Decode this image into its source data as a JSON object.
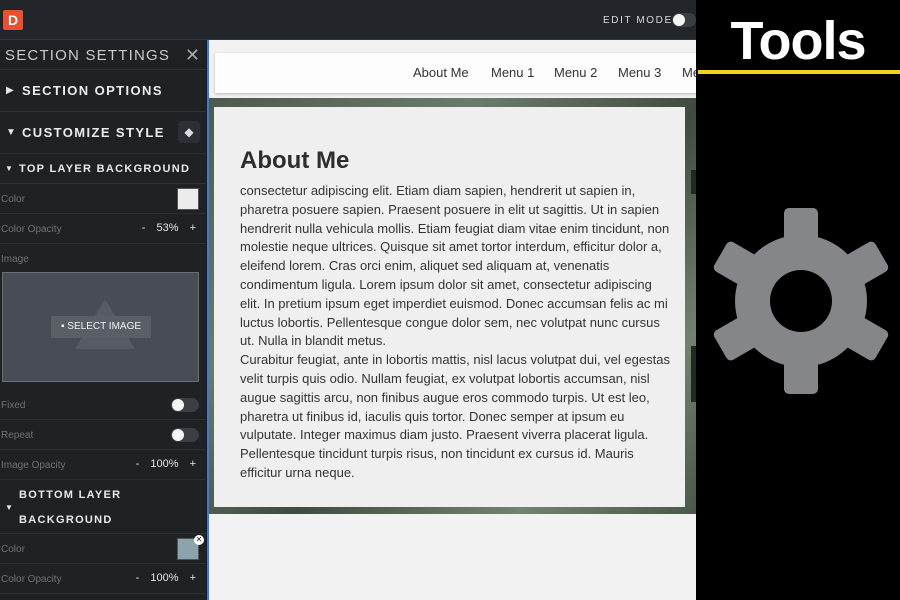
{
  "topbar": {
    "logo": "D",
    "edit_mode": "EDIT MODE"
  },
  "sidebar": {
    "title": "SECTION SETTINGS",
    "close": "✕",
    "section_options": "SECTION OPTIONS",
    "customize_style": "CUSTOMIZE STYLE",
    "top_layer": {
      "heading": "TOP LAYER BACKGROUND",
      "color_label": "Color",
      "color_value": "#ececec",
      "opacity_label": "Color Opacity",
      "opacity_value": "53%",
      "image_label": "Image",
      "select_image": "SELECT IMAGE",
      "fixed_label": "Fixed",
      "repeat_label": "Repeat",
      "image_opacity_label": "Image Opacity",
      "image_opacity_value": "100%"
    },
    "bottom_layer": {
      "heading_line1": "BOTTOM LAYER",
      "heading_line2": "BACKGROUND",
      "color_label": "Color",
      "color_value": "#8aa3ad",
      "opacity_label": "Color Opacity",
      "opacity_value": "100%"
    },
    "minus": "-",
    "plus": "+"
  },
  "preview": {
    "nav": [
      "About Me",
      "Menu 1",
      "Menu 2",
      "Menu 3",
      "Me"
    ],
    "heading": "About Me",
    "body": "consectetur adipiscing elit. Etiam diam sapien, hendrerit ut sapien in, pharetra posuere sapien. Praesent posuere in elit ut sagittis. Ut in sapien hendrerit nulla vehicula mollis. Etiam feugiat diam vitae enim tincidunt, non molestie neque ultrices. Quisque sit amet tortor interdum, efficitur dolor a, eleifend lorem. Cras orci enim, aliquet sed aliquam at, venenatis condimentum ligula. Lorem ipsum dolor sit amet, consectetur adipiscing elit. In pretium ipsum eget imperdiet euismod. Donec accumsan felis ac mi luctus lobortis. Pellentesque congue dolor sem, nec volutpat nunc cursus ut. Nulla in blandit metus.",
    "body2": "Curabitur feugiat, ante in lobortis mattis, nisl lacus volutpat dui, vel egestas velit turpis quis odio. Nullam feugiat, ex volutpat lobortis accumsan, nisl augue sagittis arcu, non finibus augue eros commodo turpis. Ut est leo, pharetra ut finibus id, iaculis quis tortor. Donec semper at ipsum eu vulputate. Integer maximus diam justo. Praesent viverra placerat ligula. Pellentesque tincidunt turpis risus, non tincidunt ex cursus id. Mauris efficitur urna neque."
  },
  "overlay": {
    "title": "Tools",
    "accent": "#f2d21b",
    "icon": "gear-icon"
  }
}
